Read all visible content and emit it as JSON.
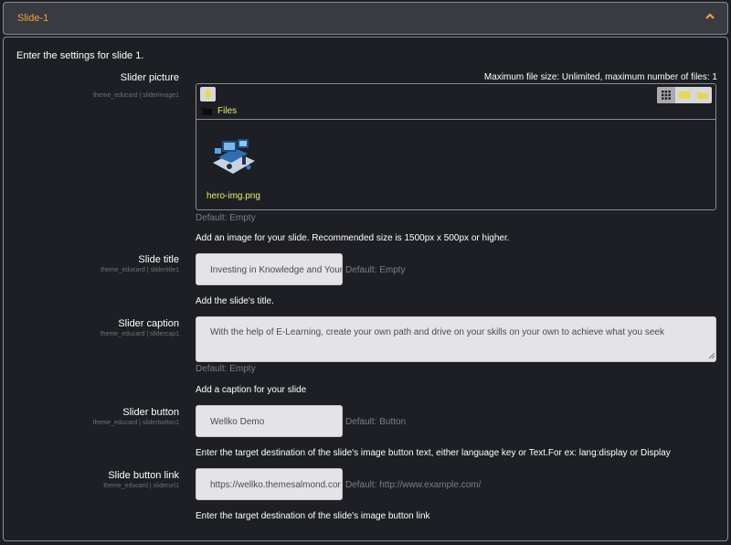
{
  "header": {
    "title": "Slide-1"
  },
  "intro": "Enter the settings for slide 1.",
  "picture": {
    "label": "Slider picture",
    "setting_id": "theme_educard | sliderimage1",
    "limits": "Maximum file size: Unlimited, maximum number of files: 1",
    "folder_label": "Files",
    "file_name": "hero-img.png",
    "default": "Default: Empty",
    "description": "Add an image for your slide. Recommended size is 1500px x 500px or higher."
  },
  "title_field": {
    "label": "Slide title",
    "setting_id": "theme_educard | slidertitle1",
    "value": "Investing in Knowledge and Your",
    "default": "Default: Empty",
    "description": "Add the slide's title."
  },
  "caption_field": {
    "label": "Slider caption",
    "setting_id": "theme_educard | slidercap1",
    "value": "With the help of E-Learning, create your own path and drive on your skills on your own to achieve what you seek",
    "default": "Default: Empty",
    "description": "Add a caption for your slide"
  },
  "button_field": {
    "label": "Slider button",
    "setting_id": "theme_educard | sliderbutton1",
    "value": "Wellko Demo",
    "default": "Default: Button",
    "description": "Enter the target destination of the slide's image button text, either language key or Text.For ex: lang:display or Display"
  },
  "link_field": {
    "label": "Slide button link",
    "setting_id": "theme_educard | sliderurl1",
    "value": "https://wellko.themesalmond.cor",
    "default": "Default: http://www.example.com/",
    "description": "Enter the target destination of the slide's image button link"
  },
  "colors": {
    "accent": "#f0a04a",
    "filename": "#dff06e",
    "field_bg": "#e4e4e6"
  },
  "icons": [
    "chevron-up-icon",
    "add-file-icon",
    "grid-view-icon",
    "list-view-icon",
    "tree-view-icon",
    "folder-icon",
    "image-thumbnail"
  ]
}
